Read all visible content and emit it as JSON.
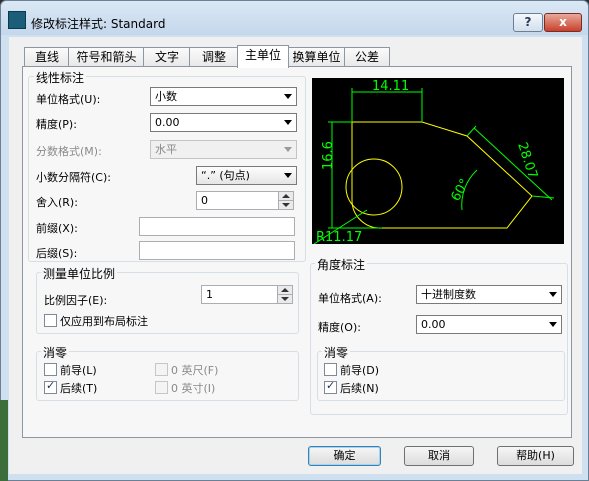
{
  "window": {
    "title": "修改标注样式: Standard",
    "help_glyph": "?",
    "close_glyph": "x"
  },
  "tabs": [
    "直线",
    "符号和箭头",
    "文字",
    "调整",
    "主单位",
    "换算单位",
    "公差"
  ],
  "active_tab": "主单位",
  "linear": {
    "group_title": "线性标注",
    "unit_format_label": "单位格式(U):",
    "unit_format_value": "小数",
    "precision_label": "精度(P):",
    "precision_value": "0.00",
    "fraction_label": "分数格式(M):",
    "fraction_value": "水平",
    "decimal_sep_label": "小数分隔符(C):",
    "decimal_sep_value": "“.” (句点)",
    "round_label": "舍入(R):",
    "round_value": "0",
    "prefix_label": "前缀(X):",
    "prefix_value": "",
    "suffix_label": "后缀(S):",
    "suffix_value": ""
  },
  "scale": {
    "group_title": "测量单位比例",
    "factor_label": "比例因子(E):",
    "factor_value": "1",
    "layout_only_label": "仅应用到布局标注",
    "layout_only_checked": false
  },
  "zero_linear": {
    "group_title": "消零",
    "leading_label": "前导(L)",
    "leading_checked": false,
    "trailing_label": "后续(T)",
    "trailing_checked": true,
    "feet_label": "0 英尺(F)",
    "inches_label": "0 英寸(I)"
  },
  "preview": {
    "dim_top": "14.11",
    "dim_left": "16.6",
    "dim_right": "28.07",
    "dim_angle": "60°",
    "dim_radius": "R11.17"
  },
  "angular": {
    "group_title": "角度标注",
    "unit_format_label": "单位格式(A):",
    "unit_format_value": "十进制度数",
    "precision_label": "精度(O):",
    "precision_value": "0.00"
  },
  "zero_angular": {
    "group_title": "消零",
    "leading_label": "前导(D)",
    "leading_checked": false,
    "trailing_label": "后续(N)",
    "trailing_checked": true
  },
  "buttons": {
    "ok": "确定",
    "cancel": "取消",
    "help": "帮助(H)"
  },
  "colors": {
    "preview_bg": "#000000",
    "geometry": "#ffff00",
    "dimension": "#00ff00"
  }
}
